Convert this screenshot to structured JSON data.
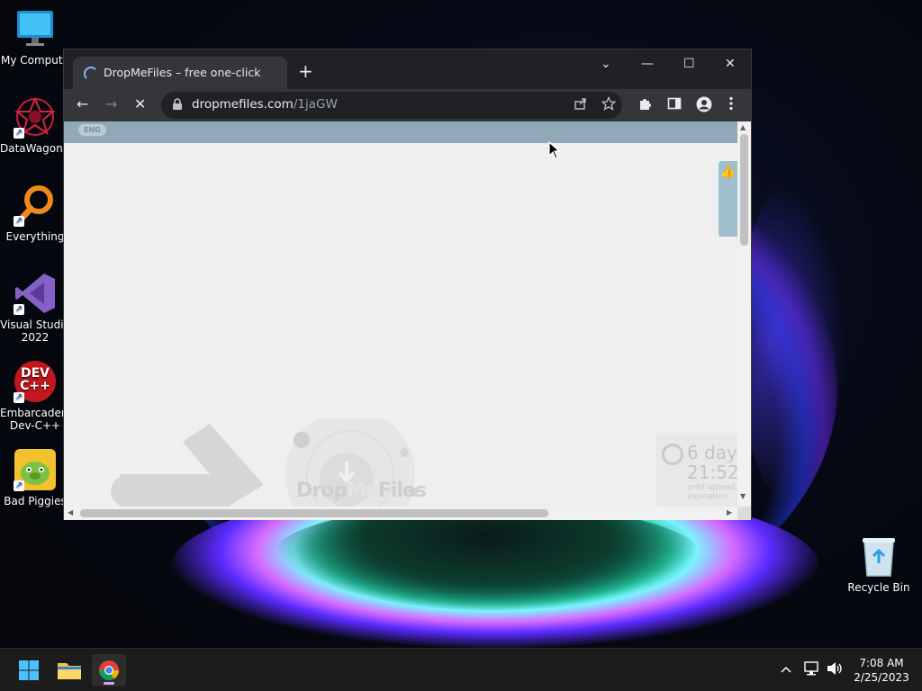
{
  "desktop": {
    "icons": [
      {
        "label": "My Compute",
        "icon": "monitor-icon"
      },
      {
        "label": "DataWagon...",
        "icon": "datawagon-icon"
      },
      {
        "label": "Everything",
        "icon": "magnifier-icon"
      },
      {
        "label": "Visual Studio 2022",
        "icon": "visual-studio-icon"
      },
      {
        "label": "Embarcadero Dev-C++",
        "icon": "devcpp-icon",
        "badge": "DEV C++"
      },
      {
        "label": "Bad Piggies",
        "icon": "bad-piggies-icon"
      }
    ],
    "recycle_bin": {
      "label": "Recycle Bin",
      "icon": "recycle-bin-icon"
    }
  },
  "browser": {
    "tab": {
      "title": "DropMeFiles – free one-click file sharing",
      "close": "×"
    },
    "new_tab": "+",
    "controls": {
      "dropdown": "⌄",
      "minimize": "—",
      "maximize": "☐",
      "close": "✕"
    },
    "toolbar": {
      "back": "←",
      "forward": "→",
      "stop": "✕"
    },
    "omnibox": {
      "host": "dropmefiles.com",
      "path": "/1jaGW"
    },
    "page": {
      "lang": "ENG",
      "logo": {
        "part1": "Drop",
        "part2": "Me",
        "part3": "Files"
      },
      "timer": {
        "days": "6 day",
        "time": "21:52",
        "caption": "until upload expiration"
      }
    }
  },
  "taskbar": {
    "clock": {
      "time": "7:08 AM",
      "date": "2/25/2023"
    },
    "accent": "#d9a3ff"
  }
}
